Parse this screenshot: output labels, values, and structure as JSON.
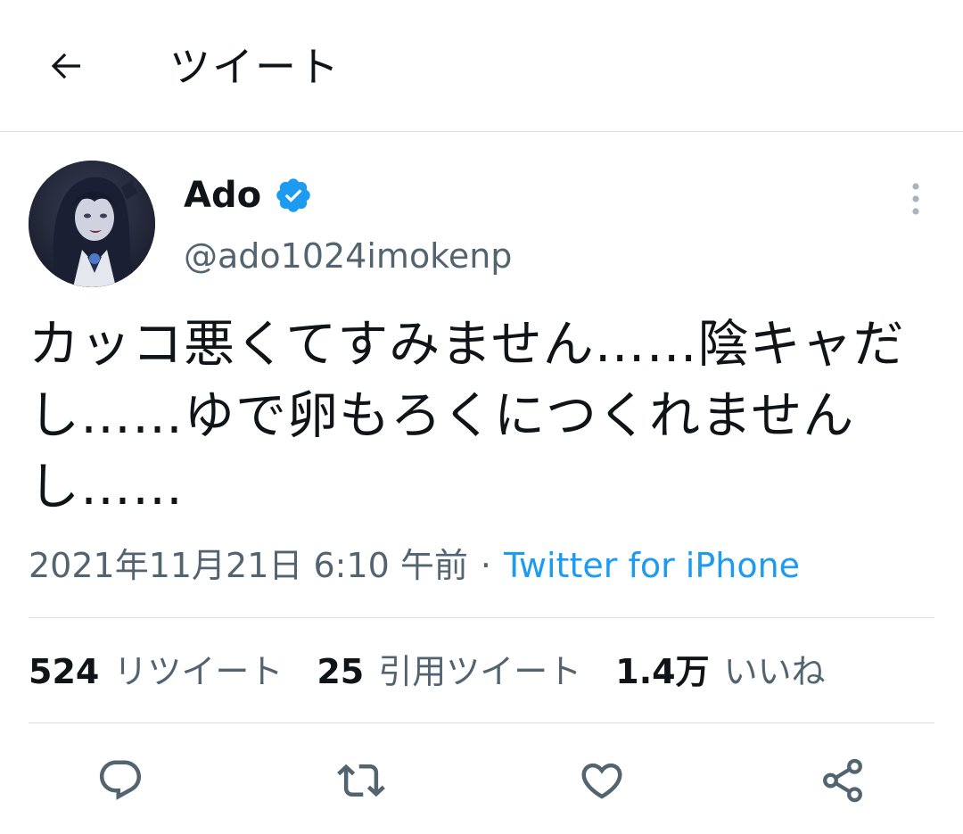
{
  "header": {
    "title": "ツイート",
    "back_icon": "arrow-left-icon"
  },
  "tweet": {
    "author": {
      "display_name": "Ado",
      "handle": "@ado1024imokenp",
      "verified": true,
      "verified_color": "#1d9bf0"
    },
    "text": "カッコ悪くてすみません……陰キャだし……ゆで卵もろくにつくれませんし……",
    "date": "2021年11月21日 6:10 午前",
    "separator": "·",
    "source": "Twitter for iPhone"
  },
  "stats": {
    "retweets": {
      "value": "524",
      "label": "リツイート"
    },
    "quotes": {
      "value": "25",
      "label": "引用ツイート"
    },
    "likes": {
      "value": "1.4万",
      "label": "いいね"
    }
  },
  "actions": [
    {
      "name": "reply",
      "icon": "reply-icon"
    },
    {
      "name": "retweet",
      "icon": "retweet-icon"
    },
    {
      "name": "like",
      "icon": "heart-icon"
    },
    {
      "name": "share",
      "icon": "share-icon"
    }
  ],
  "colors": {
    "accent": "#1d9bf0",
    "text": "#0f1419",
    "secondary": "#536471",
    "divider": "#dcdfe2"
  }
}
